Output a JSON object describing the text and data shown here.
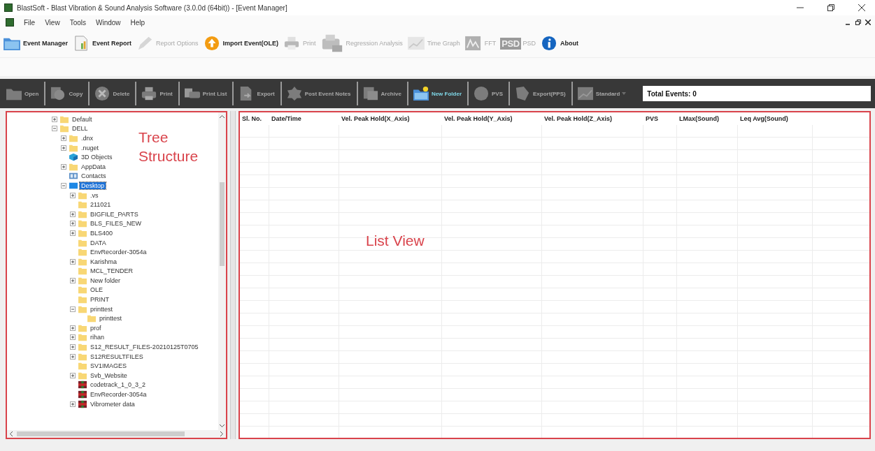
{
  "window": {
    "title": "BlastSoft - Blast Vibration & Sound Analysis Software (3.0.0d (64bit)) - [Event Manager]"
  },
  "menu": [
    "File",
    "View",
    "Tools",
    "Window",
    "Help"
  ],
  "toolbar": [
    {
      "label": "Event Manager",
      "kind": "manager",
      "disabled": false
    },
    {
      "label": "Event Report",
      "kind": "report",
      "disabled": false
    },
    {
      "label": "Report Options",
      "kind": "options",
      "disabled": true
    },
    {
      "label": "Import Event(OLE)",
      "kind": "import",
      "disabled": false
    },
    {
      "label": "Print",
      "kind": "print",
      "disabled": true
    },
    {
      "label": "Regression Analysis",
      "kind": "regression",
      "disabled": true
    },
    {
      "label": "Time Graph",
      "kind": "graph",
      "disabled": true
    },
    {
      "label": "FFT",
      "kind": "fft",
      "disabled": true
    },
    {
      "label": "PSD",
      "kind": "psd",
      "icon_text": "PSD",
      "disabled": true
    },
    {
      "label": "About",
      "kind": "about",
      "disabled": false
    }
  ],
  "event_toolbar": [
    {
      "label": "Open",
      "kind": "open",
      "disabled": true
    },
    {
      "label": "Copy",
      "kind": "copy",
      "disabled": true
    },
    {
      "label": "Delete",
      "kind": "delete",
      "disabled": true
    },
    {
      "label": "Print",
      "kind": "print",
      "disabled": true
    },
    {
      "label": "Print List",
      "kind": "printlist",
      "disabled": true
    },
    {
      "label": "Export",
      "kind": "export",
      "disabled": true
    },
    {
      "label": "Post Event Notes",
      "kind": "notes",
      "disabled": true
    },
    {
      "label": "Archive",
      "kind": "archive",
      "disabled": true
    },
    {
      "label": "New Folder",
      "kind": "newfolder",
      "disabled": false
    },
    {
      "label": "PVS",
      "kind": "pvs",
      "disabled": true
    },
    {
      "label": "Export(PPS)",
      "kind": "export2",
      "disabled": true
    },
    {
      "label": "Standard",
      "kind": "dropdown",
      "disabled": true
    }
  ],
  "total_events": "Total Events: 0",
  "tree": {
    "annotation": "Tree Structure",
    "items": [
      {
        "label": "Default",
        "kind": "folder",
        "expanded": false,
        "selected": false
      },
      {
        "label": "DELL",
        "kind": "folder",
        "expanded": true,
        "selected": false,
        "children": [
          {
            "label": ".dnx",
            "kind": "folder",
            "expanded": false,
            "selected": false
          },
          {
            "label": ".nuget",
            "kind": "folder",
            "expanded": false,
            "selected": false
          },
          {
            "label": "3D Objects",
            "kind": "objects",
            "selected": false
          },
          {
            "label": "AppData",
            "kind": "folder",
            "expanded": false,
            "selected": false
          },
          {
            "label": "Contacts",
            "kind": "contacts",
            "selected": false
          },
          {
            "label": "Desktop",
            "kind": "desktop",
            "expanded": true,
            "selected": true,
            "children": [
              {
                "label": ".vs",
                "kind": "folder",
                "expanded": false,
                "selected": false
              },
              {
                "label": "211021",
                "kind": "folder",
                "selected": false
              },
              {
                "label": "BIGFILE_PARTS",
                "kind": "folder",
                "expanded": false,
                "selected": false
              },
              {
                "label": "BLS_FILES_NEW",
                "kind": "folder",
                "expanded": false,
                "selected": false
              },
              {
                "label": "BLS400",
                "kind": "folder",
                "expanded": false,
                "selected": false
              },
              {
                "label": "DATA",
                "kind": "folder",
                "selected": false
              },
              {
                "label": "EnvRecorder-3054a",
                "kind": "folder",
                "selected": false
              },
              {
                "label": "Karishma",
                "kind": "folder",
                "expanded": false,
                "selected": false
              },
              {
                "label": "MCL_TENDER",
                "kind": "folder",
                "selected": false
              },
              {
                "label": "New folder",
                "kind": "folder",
                "expanded": false,
                "selected": false
              },
              {
                "label": "OLE",
                "kind": "folder",
                "selected": false
              },
              {
                "label": "PRINT",
                "kind": "folder",
                "selected": false
              },
              {
                "label": "printtest",
                "kind": "folder",
                "expanded": true,
                "selected": false,
                "children": [
                  {
                    "label": "printtest",
                    "kind": "folder",
                    "selected": false
                  }
                ]
              },
              {
                "label": "prof",
                "kind": "folder",
                "expanded": false,
                "selected": false
              },
              {
                "label": "rihan",
                "kind": "folder",
                "expanded": false,
                "selected": false
              },
              {
                "label": "S12_RESULT_FILES-20210125T0705",
                "kind": "folder",
                "expanded": false,
                "selected": false
              },
              {
                "label": "S12RESULTFILES",
                "kind": "folder",
                "expanded": false,
                "selected": false
              },
              {
                "label": "SV1IMAGES",
                "kind": "folder",
                "selected": false
              },
              {
                "label": "Svb_Website",
                "kind": "folder",
                "expanded": false,
                "selected": false
              },
              {
                "label": "codetrack_1_0_3_2",
                "kind": "app",
                "selected": false
              },
              {
                "label": "EnvRecorder-3054a",
                "kind": "app",
                "selected": false
              },
              {
                "label": "Vibrometer data",
                "kind": "app",
                "expanded": false,
                "selected": false
              }
            ]
          }
        ]
      }
    ]
  },
  "table": {
    "annotation": "List View",
    "columns": [
      "Sl. No.",
      "Date/Time",
      "Vel. Peak Hold(X_Axis)",
      "Vel. Peak Hold(Y_Axis)",
      "Vel. Peak Hold(Z_Axis)",
      "PVS",
      "LMax(Sound)",
      "Leq Avg(Sound)"
    ]
  }
}
